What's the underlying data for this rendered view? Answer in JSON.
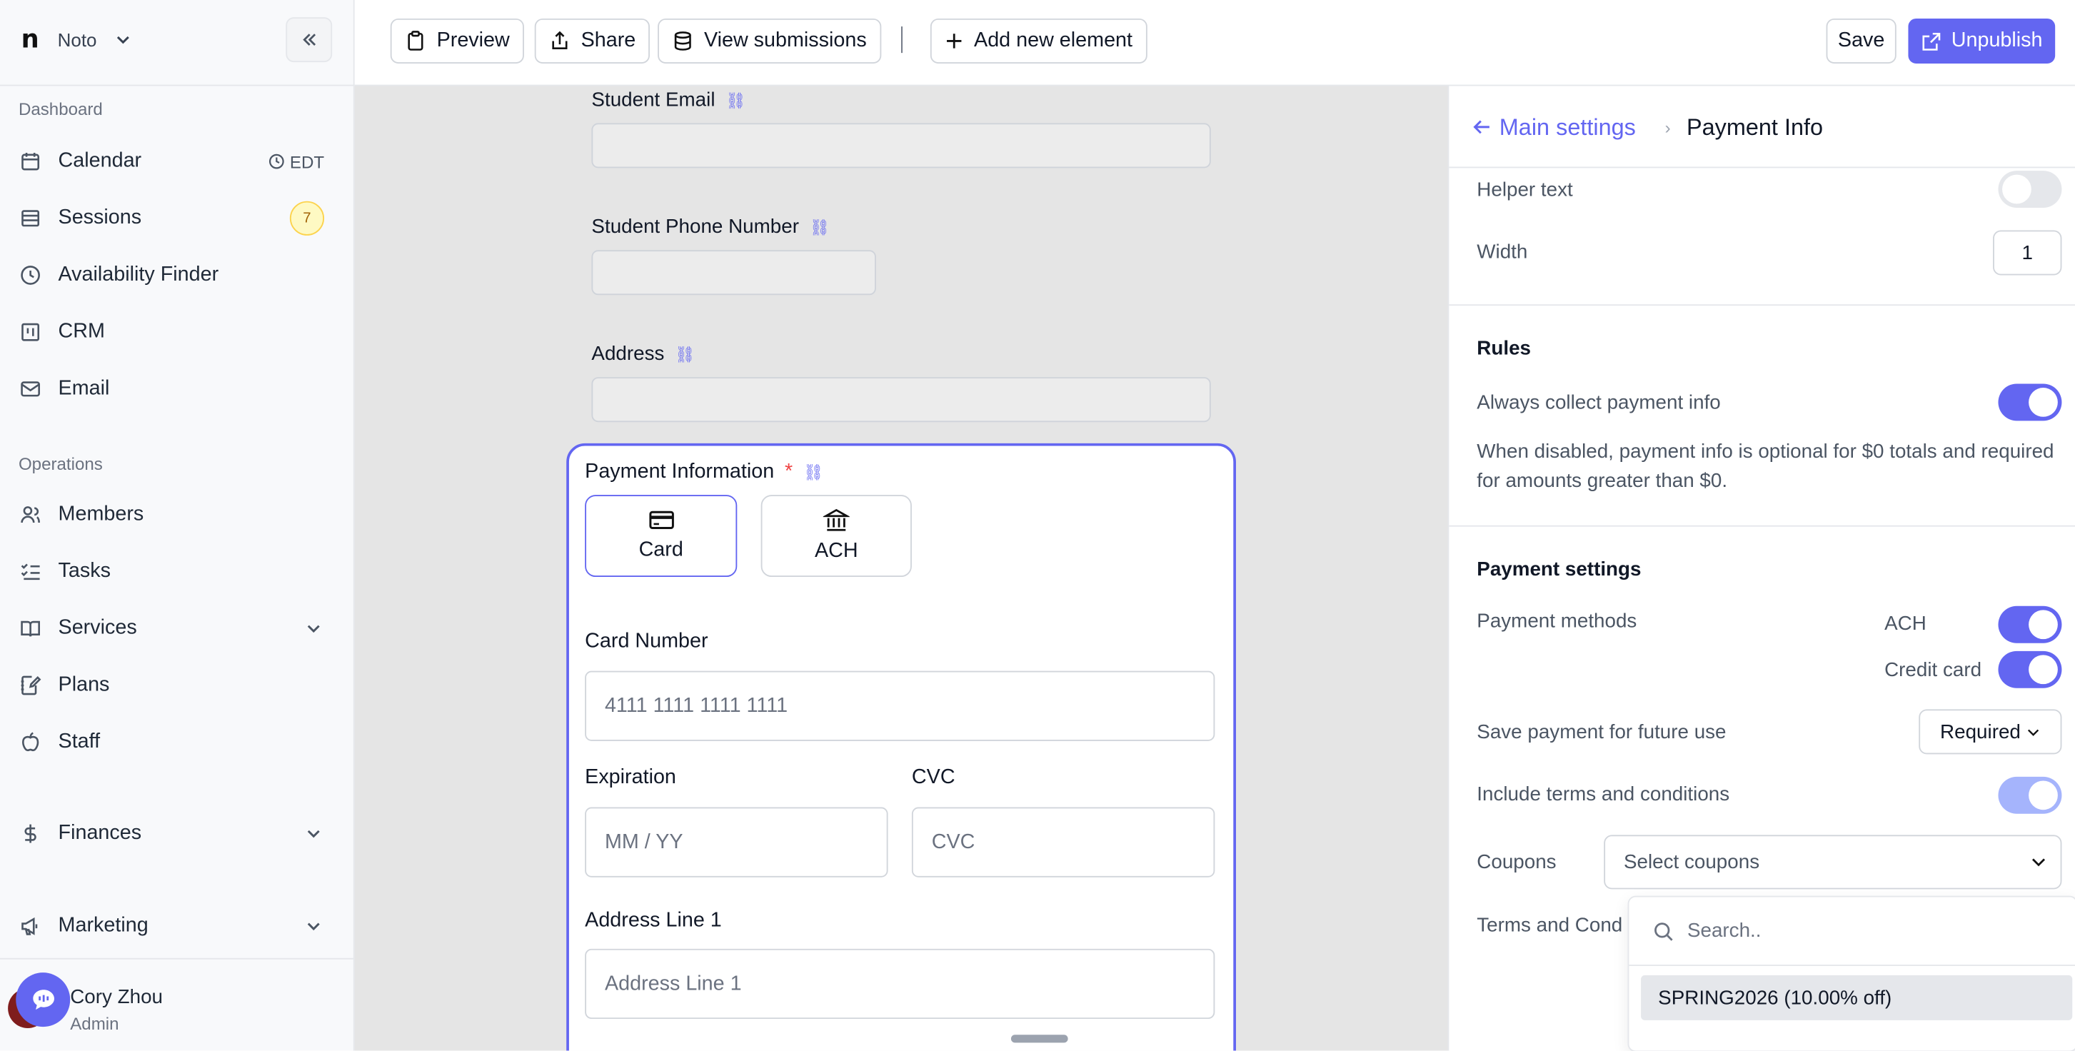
{
  "sidebar": {
    "workspace": "Noto",
    "sections": {
      "dashboard": "Dashboard",
      "operations": "Operations"
    },
    "items": [
      {
        "label": "Calendar",
        "extra": "EDT"
      },
      {
        "label": "Sessions",
        "badge": "7"
      },
      {
        "label": "Availability Finder"
      },
      {
        "label": "CRM"
      },
      {
        "label": "Email"
      },
      {
        "label": "Members"
      },
      {
        "label": "Tasks"
      },
      {
        "label": "Services"
      },
      {
        "label": "Plans"
      },
      {
        "label": "Staff"
      },
      {
        "label": "Finances"
      },
      {
        "label": "Marketing"
      }
    ],
    "user": {
      "name": "Cory Zhou",
      "role": "Admin"
    }
  },
  "toolbar": {
    "preview": "Preview",
    "share": "Share",
    "view_submissions": "View submissions",
    "separator": "|",
    "add_element": "Add new element",
    "save": "Save",
    "unpublish": "Unpublish"
  },
  "form": {
    "student_email": "Student Email",
    "student_phone": "Student Phone Number",
    "address": "Address",
    "payment": {
      "title": "Payment Information",
      "required_mark": "*",
      "methods": [
        "Card",
        "ACH"
      ],
      "card_number_label": "Card Number",
      "card_number_placeholder": "4111 1111 1111 1111",
      "expiration_label": "Expiration",
      "expiration_placeholder": "MM / YY",
      "cvc_label": "CVC",
      "cvc_placeholder": "CVC",
      "address1_label": "Address Line 1",
      "address1_placeholder": "Address Line 1"
    }
  },
  "settings": {
    "back_label": "Main settings",
    "current": "Payment Info",
    "helper_text": "Helper text",
    "width_label": "Width",
    "width_value": "1",
    "rules_heading": "Rules",
    "always_collect": "Always collect payment info",
    "always_collect_desc": "When disabled, payment info is optional for $0 totals and required for amounts greater than $0.",
    "payment_settings_heading": "Payment settings",
    "payment_methods_label": "Payment methods",
    "ach_label": "ACH",
    "credit_card_label": "Credit card",
    "save_payment_label": "Save payment for future use",
    "save_payment_value": "Required",
    "terms_label": "Include terms and conditions",
    "coupons_label": "Coupons",
    "coupons_placeholder": "Select coupons",
    "terms_cond_label": "Terms and Cond",
    "coupon_search_placeholder": "Search..",
    "coupon_options": [
      "SPRING2026 (10.00% off)"
    ]
  },
  "colors": {
    "accent": "#6366f1",
    "canvas_bg": "#e5e5e5"
  }
}
